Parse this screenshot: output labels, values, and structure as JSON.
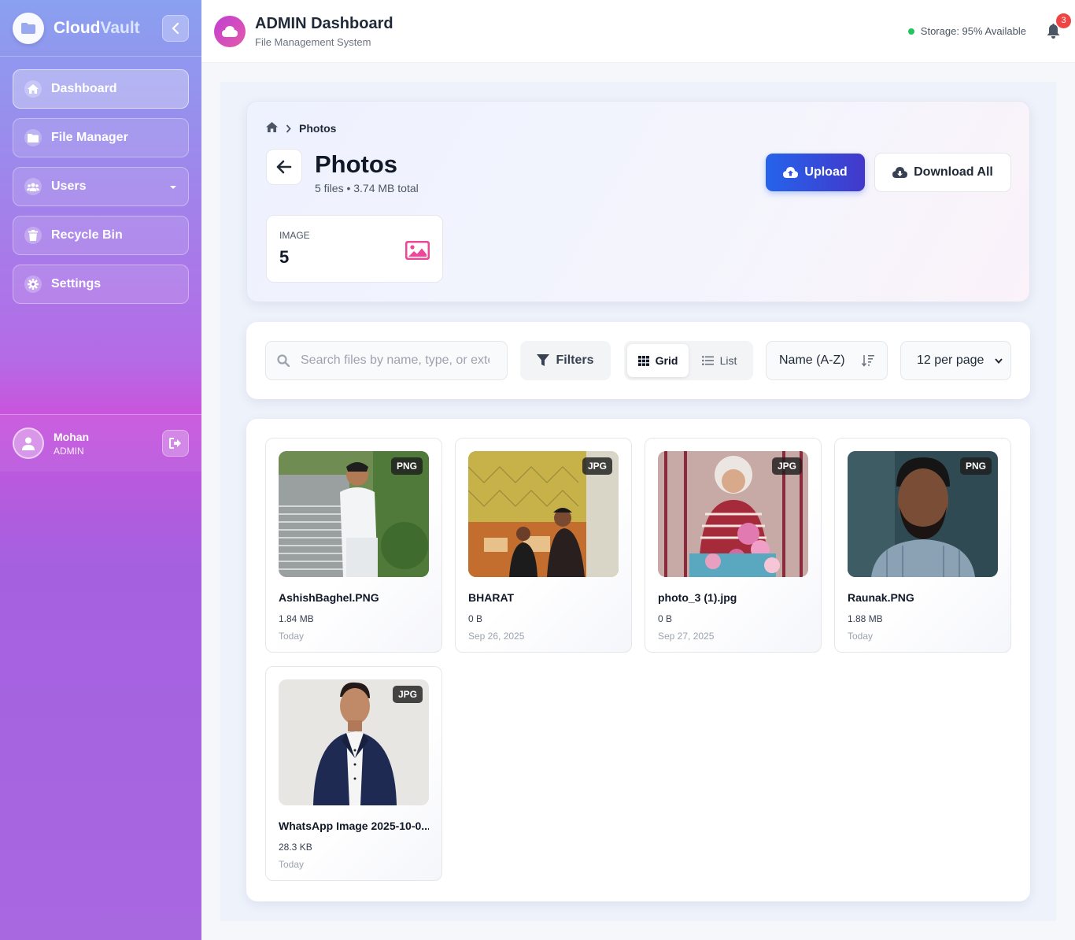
{
  "app": {
    "name_main": "Cloud",
    "name_accent": "Vault"
  },
  "sidebar": {
    "items": [
      {
        "label": "Dashboard",
        "icon": "home-icon",
        "active": true
      },
      {
        "label": "File Manager",
        "icon": "folder-icon"
      },
      {
        "label": "Users",
        "icon": "users-icon",
        "has_dropdown": true
      },
      {
        "label": "Recycle Bin",
        "icon": "trash-icon"
      },
      {
        "label": "Settings",
        "icon": "gear-icon"
      }
    ],
    "user": {
      "name": "Mohan",
      "role": "ADMIN"
    }
  },
  "header": {
    "title": "ADMIN Dashboard",
    "subtitle": "File Management System",
    "storage_text": "Storage: 95% Available",
    "notification_count": "3"
  },
  "folder": {
    "breadcrumb_current": "Photos",
    "title": "Photos",
    "meta": "5 files • 3.74 MB total",
    "upload_label": "Upload",
    "download_all_label": "Download All",
    "stat": {
      "label": "IMAGE",
      "value": "5"
    }
  },
  "toolbar": {
    "search_placeholder": "Search files by name, type, or extension...",
    "search_value": "",
    "filters_label": "Filters",
    "view_grid_label": "Grid",
    "view_list_label": "List",
    "active_view": "Grid",
    "sort_label": "Name (A-Z)",
    "per_page_label": "12 per page"
  },
  "files": [
    {
      "name": "AshishBaghel.PNG",
      "ext": "PNG",
      "size": "1.84 MB",
      "date": "Today"
    },
    {
      "name": "BHARAT",
      "ext": "JPG",
      "size": "0 B",
      "date": "Sep 26, 2025"
    },
    {
      "name": "photo_3 (1).jpg",
      "ext": "JPG",
      "size": "0 B",
      "date": "Sep 27, 2025"
    },
    {
      "name": "Raunak.PNG",
      "ext": "PNG",
      "size": "1.88 MB",
      "date": "Today"
    },
    {
      "name": "WhatsApp Image 2025-10-0...",
      "ext": "JPG",
      "size": "28.3 KB",
      "date": "Today"
    }
  ],
  "colors": {
    "primary": "#2563eb",
    "accent": "#c855dc",
    "status_ok": "#22c55e",
    "badge": "#ef4444",
    "image_stat": "#ec4899"
  }
}
